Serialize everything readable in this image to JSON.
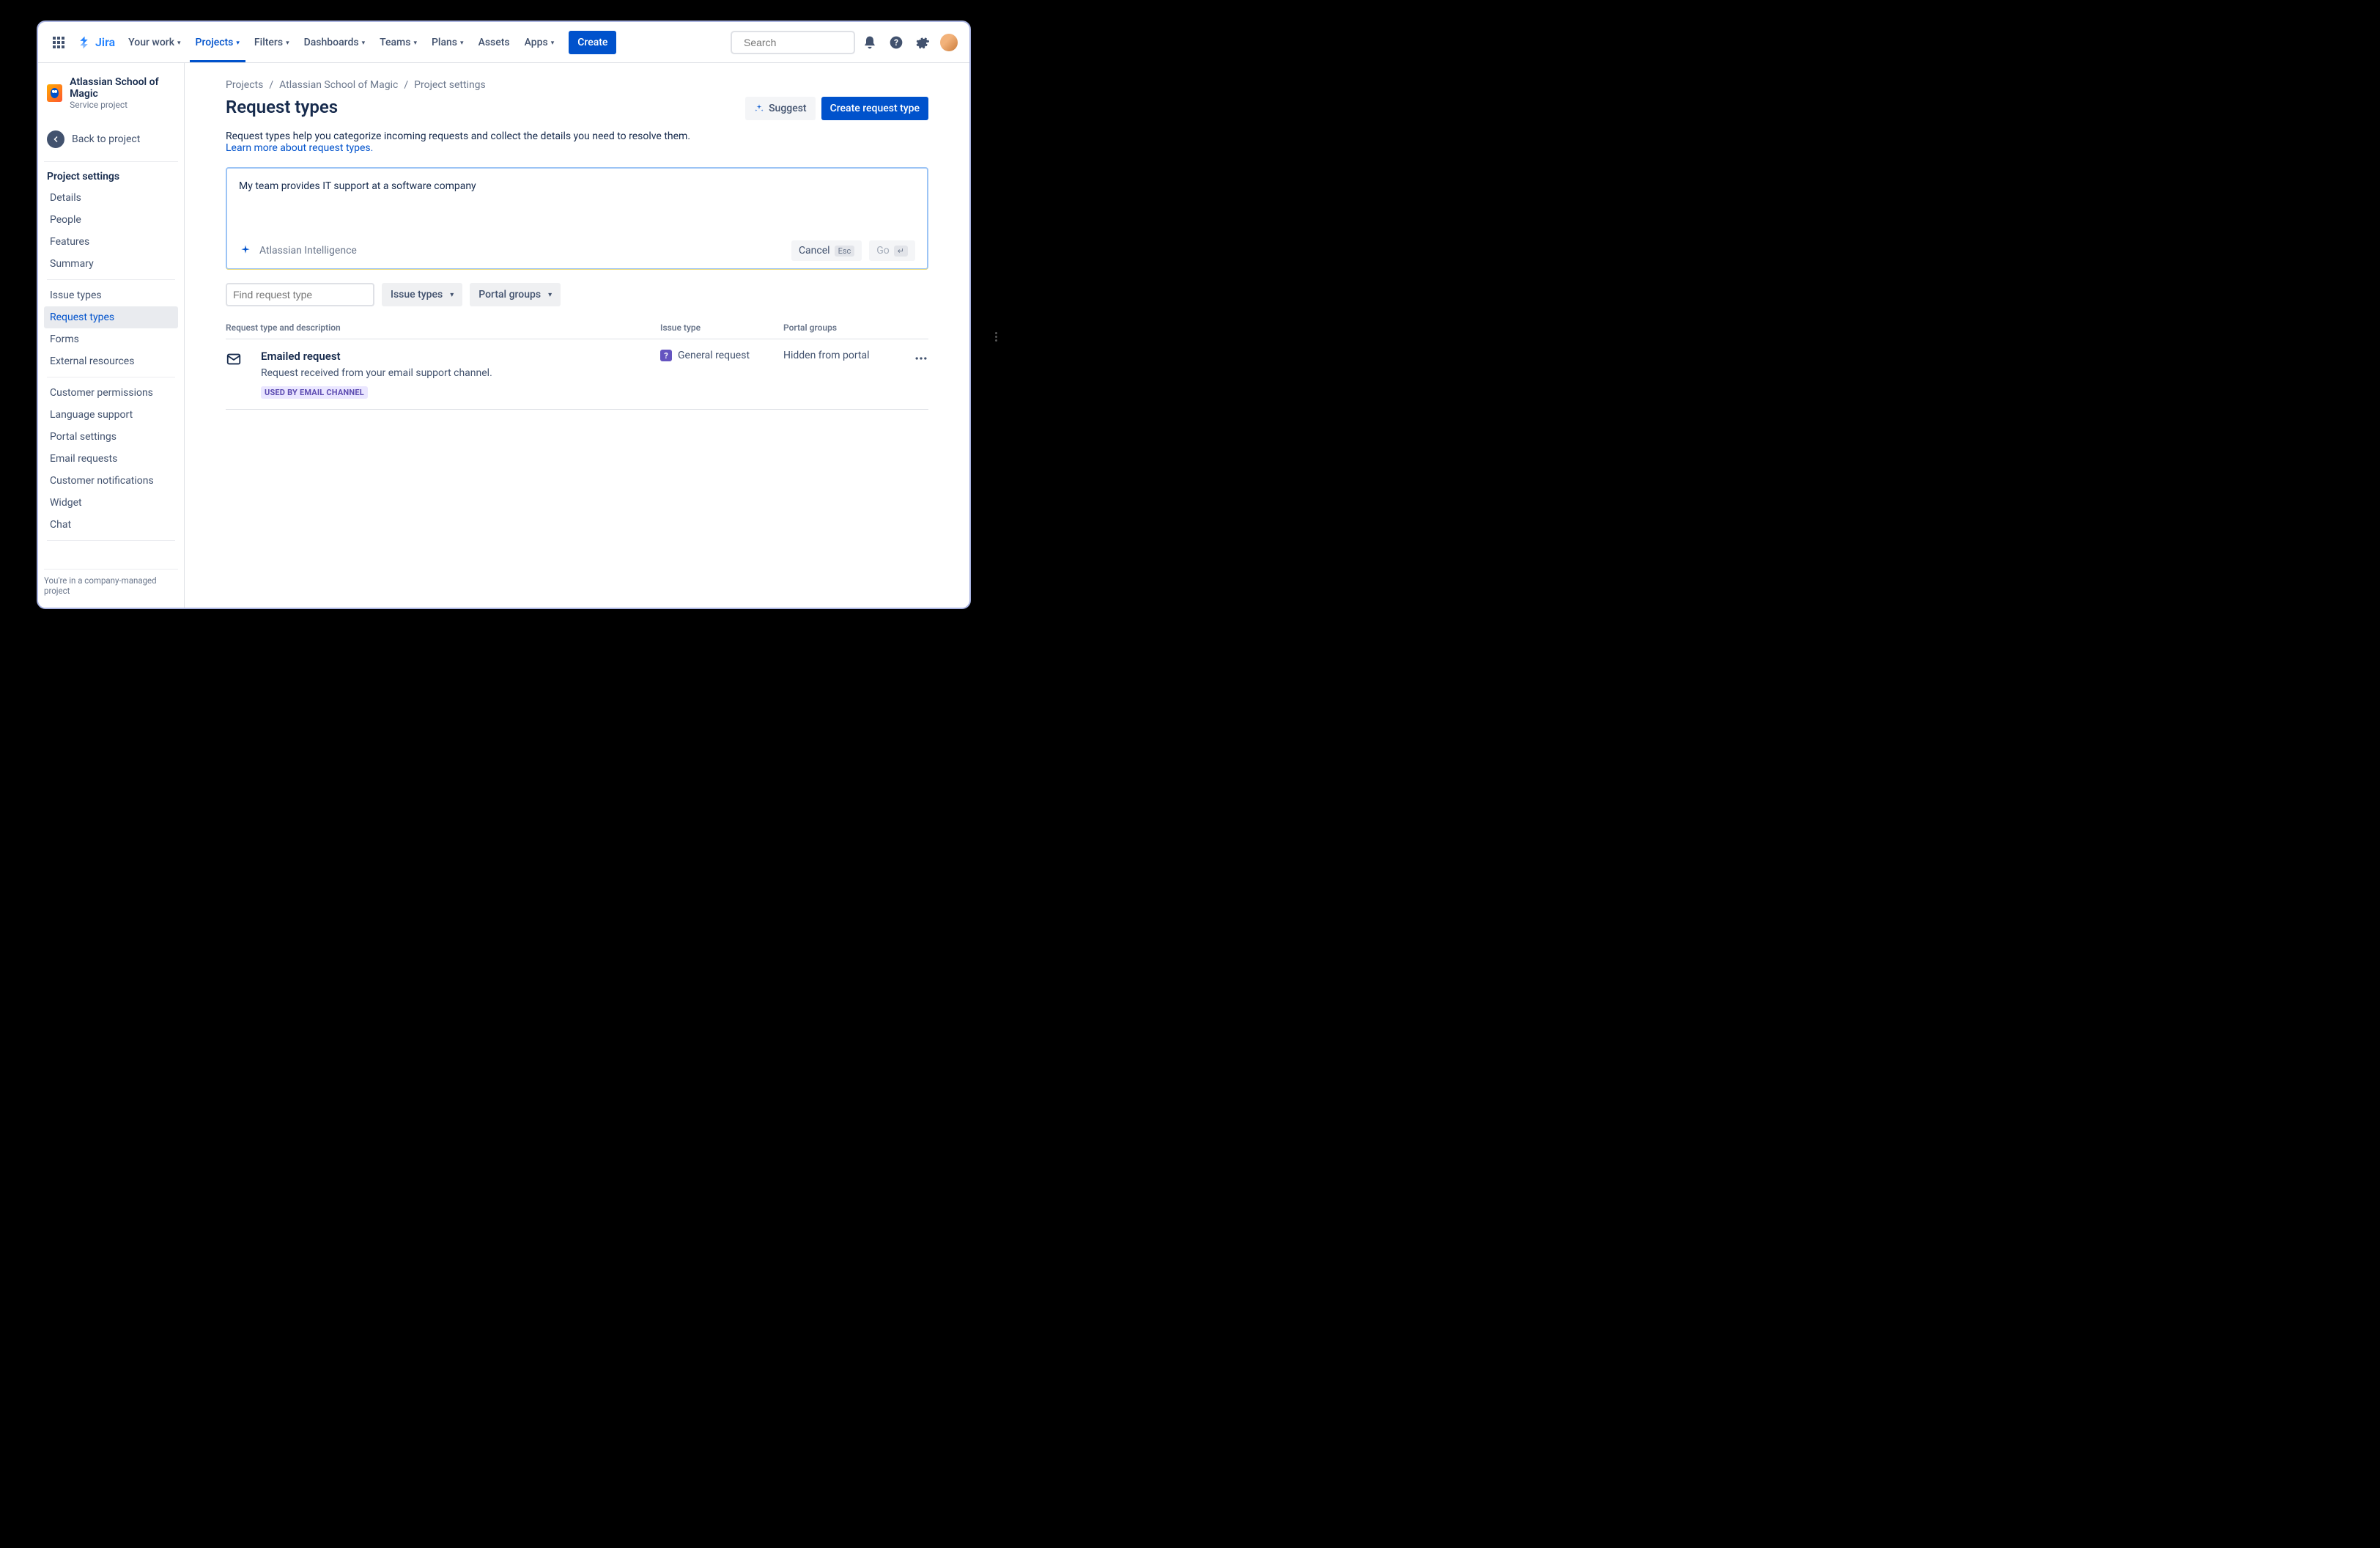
{
  "topnav": {
    "logo_text": "Jira",
    "items": [
      {
        "label": "Your work",
        "dropdown": true,
        "active": false
      },
      {
        "label": "Projects",
        "dropdown": true,
        "active": true
      },
      {
        "label": "Filters",
        "dropdown": true,
        "active": false
      },
      {
        "label": "Dashboards",
        "dropdown": true,
        "active": false
      },
      {
        "label": "Teams",
        "dropdown": true,
        "active": false
      },
      {
        "label": "Plans",
        "dropdown": true,
        "active": false
      },
      {
        "label": "Assets",
        "dropdown": false,
        "active": false
      },
      {
        "label": "Apps",
        "dropdown": true,
        "active": false
      }
    ],
    "create_label": "Create",
    "search_placeholder": "Search"
  },
  "sidebar": {
    "project_name": "Atlassian School of Magic",
    "project_type": "Service project",
    "back_label": "Back to project",
    "settings_heading": "Project settings",
    "group1": [
      "Details",
      "People",
      "Features",
      "Summary"
    ],
    "group2": [
      "Issue types",
      "Request types",
      "Forms",
      "External resources"
    ],
    "group2_selected": "Request types",
    "group3": [
      "Customer permissions",
      "Language support",
      "Portal settings",
      "Email requests",
      "Customer notifications",
      "Widget",
      "Chat"
    ],
    "footer": "You're in a company-managed project"
  },
  "breadcrumbs": [
    "Projects",
    "Atlassian School of Magic",
    "Project settings"
  ],
  "page": {
    "title": "Request types",
    "suggest_label": "Suggest",
    "create_label": "Create request type",
    "desc_text": "Request types help you categorize incoming requests and collect the details you need to resolve them.",
    "desc_link": "Learn more about request types."
  },
  "ai": {
    "input_text": "My team provides IT support at a software company",
    "brand_label": "Atlassian Intelligence",
    "cancel_label": "Cancel",
    "cancel_kbd": "Esc",
    "go_label": "Go",
    "go_kbd": "↵"
  },
  "filters": {
    "find_placeholder": "Find request type",
    "dd1": "Issue types",
    "dd2": "Portal groups"
  },
  "table": {
    "col1": "Request type and description",
    "col2": "Issue type",
    "col3": "Portal groups",
    "rows": [
      {
        "title": "Emailed request",
        "desc": "Request received from your email support channel.",
        "lozenge": "USED BY EMAIL CHANNEL",
        "issue_type": "General request",
        "portal": "Hidden from portal"
      }
    ]
  }
}
